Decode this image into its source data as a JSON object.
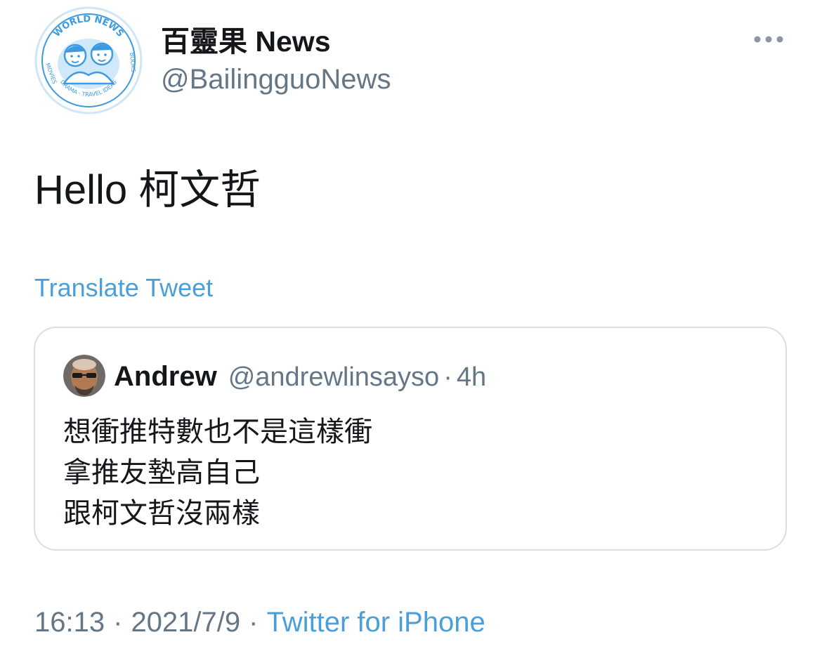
{
  "tweet": {
    "author": {
      "name": "百靈果 News",
      "handle": "@BailingguoNews",
      "avatar": {
        "logo_top": "WORLD NEWS",
        "logo_left": "MOVIES",
        "logo_bottom": "DRAMA · TRAVEL IDEAS",
        "logo_right": "BOOKS"
      }
    },
    "more_icon": "more-horizontal-icon",
    "text": "Hello 柯文哲",
    "translate_label": "Translate Tweet",
    "quoted": {
      "name": "Andrew",
      "handle": "@andrewlinsayso",
      "separator": "·",
      "time": "4h",
      "lines": [
        "想衝推特數也不是這樣衝",
        "拿推友墊高自己",
        "跟柯文哲沒兩樣"
      ]
    },
    "meta": {
      "time": "16:13",
      "separator": "·",
      "date": "2021/7/9",
      "source": "Twitter for iPhone"
    }
  },
  "colors": {
    "text": "#14171a",
    "secondary": "#657786",
    "link": "#4b9fd8",
    "border": "#d9dfe3",
    "logo_blue": "#3c9be0"
  }
}
